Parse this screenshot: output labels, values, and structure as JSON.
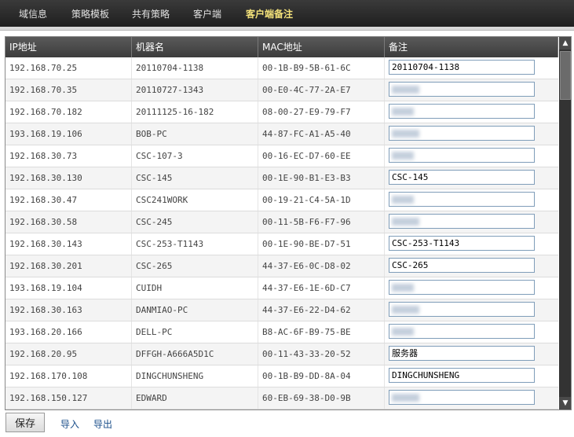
{
  "nav": {
    "tabs": [
      {
        "label": "域信息",
        "active": false
      },
      {
        "label": "策略模板",
        "active": false
      },
      {
        "label": "共有策略",
        "active": false
      },
      {
        "label": "客户端",
        "active": false
      },
      {
        "label": "客户端备注",
        "active": true
      }
    ]
  },
  "table": {
    "headers": [
      "IP地址",
      "机器名",
      "MAC地址",
      "备注"
    ],
    "rows": [
      {
        "ip": "192.168.70.25",
        "name": "20110704-1138",
        "mac": "00-1B-B9-5B-61-6C",
        "note": "20110704-1138",
        "note_blurred": false
      },
      {
        "ip": "192.168.70.35",
        "name": "20110727-1343",
        "mac": "00-E0-4C-77-2A-E7",
        "note": "",
        "note_blurred": true
      },
      {
        "ip": "192.168.70.182",
        "name": "20111125-16-182",
        "mac": "08-00-27-E9-79-F7",
        "note": "",
        "note_blurred": true
      },
      {
        "ip": "193.168.19.106",
        "name": "BOB-PC",
        "mac": "44-87-FC-A1-A5-40",
        "note": "",
        "note_blurred": true
      },
      {
        "ip": "192.168.30.73",
        "name": "CSC-107-3",
        "mac": "00-16-EC-D7-60-EE",
        "note": "",
        "note_blurred": true
      },
      {
        "ip": "192.168.30.130",
        "name": "CSC-145",
        "mac": "00-1E-90-B1-E3-B3",
        "note": "CSC-145",
        "note_blurred": false
      },
      {
        "ip": "192.168.30.47",
        "name": "CSC241WORK",
        "mac": "00-19-21-C4-5A-1D",
        "note": "",
        "note_blurred": true
      },
      {
        "ip": "192.168.30.58",
        "name": "CSC-245",
        "mac": "00-11-5B-F6-F7-96",
        "note": "",
        "note_blurred": true
      },
      {
        "ip": "192.168.30.143",
        "name": "CSC-253-T1143",
        "mac": "00-1E-90-BE-D7-51",
        "note": "CSC-253-T1143",
        "note_blurred": false
      },
      {
        "ip": "192.168.30.201",
        "name": "CSC-265",
        "mac": "44-37-E6-0C-D8-02",
        "note": "CSC-265",
        "note_blurred": false
      },
      {
        "ip": "193.168.19.104",
        "name": "CUIDH",
        "mac": "44-37-E6-1E-6D-C7",
        "note": "",
        "note_blurred": true
      },
      {
        "ip": "192.168.30.163",
        "name": "DANMIAO-PC",
        "mac": "44-37-E6-22-D4-62",
        "note": "",
        "note_blurred": true
      },
      {
        "ip": "193.168.20.166",
        "name": "DELL-PC",
        "mac": "B8-AC-6F-B9-75-BE",
        "note": "",
        "note_blurred": true
      },
      {
        "ip": "192.168.20.95",
        "name": "DFFGH-A666A5D1C",
        "mac": "00-11-43-33-20-52",
        "note": "服务器",
        "note_blurred": false
      },
      {
        "ip": "192.168.170.108",
        "name": "DINGCHUNSHENG",
        "mac": "00-1B-B9-DD-8A-04",
        "note": "DINGCHUNSHENG",
        "note_blurred": false
      },
      {
        "ip": "192.168.150.127",
        "name": "EDWARD",
        "mac": "60-EB-69-38-D0-9B",
        "note": "",
        "note_blurred": true
      }
    ]
  },
  "footer": {
    "save_label": "保存",
    "import_label": "导入",
    "export_label": "导出"
  }
}
